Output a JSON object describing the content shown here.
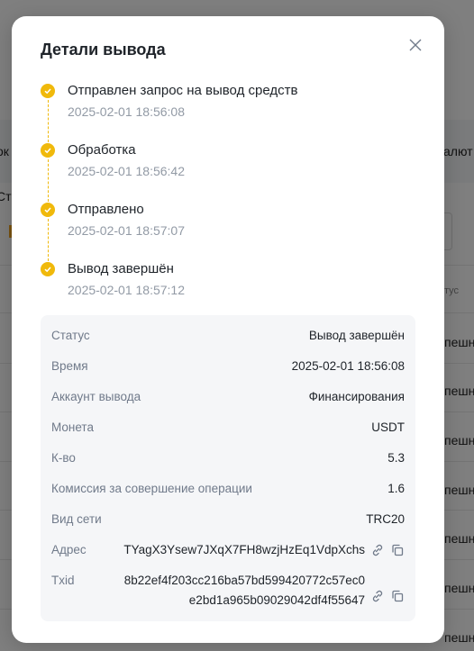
{
  "background": {
    "left_fragments": [
      "ок",
      "Ст"
    ],
    "right_header": "алют",
    "right_col": "тус",
    "right_rows": [
      "пешно",
      "пешно",
      "пешно",
      "пешно",
      "пешно",
      "пешно",
      "пешно"
    ]
  },
  "modal": {
    "title": "Детали вывода",
    "close_icon": "close-icon"
  },
  "timeline": [
    {
      "title": "Отправлен запрос на вывод средств",
      "time": "2025-02-01 18:56:08"
    },
    {
      "title": "Обработка",
      "time": "2025-02-01 18:56:42"
    },
    {
      "title": "Отправлено",
      "time": "2025-02-01 18:57:07"
    },
    {
      "title": "Вывод завершён",
      "time": "2025-02-01 18:57:12"
    }
  ],
  "details": {
    "status": {
      "label": "Статус",
      "value": "Вывод завершён"
    },
    "time": {
      "label": "Время",
      "value": "2025-02-01 18:56:08"
    },
    "account": {
      "label": "Аккаунт вывода",
      "value": "Финансирования"
    },
    "coin": {
      "label": "Монета",
      "value": "USDT"
    },
    "amount": {
      "label": "К-во",
      "value": "5.3"
    },
    "fee": {
      "label": "Комиссия за совершение операции",
      "value": "1.6"
    },
    "network": {
      "label": "Вид сети",
      "value": "TRC20"
    },
    "address": {
      "label": "Адрес",
      "value": "TYagX3Ysew7JXqX7FH8wzjHzEq1VdpXchs"
    },
    "txid": {
      "label": "Txid",
      "line1": "8b22ef4f203cc216ba57bd599420772c57ec0",
      "line2": "e2bd1a965b09029042df4f55647"
    }
  },
  "colors": {
    "accent": "#f0b90b",
    "text_primary": "#1e2329",
    "text_secondary": "#929aa5",
    "panel_bg": "#f5f6f8"
  }
}
